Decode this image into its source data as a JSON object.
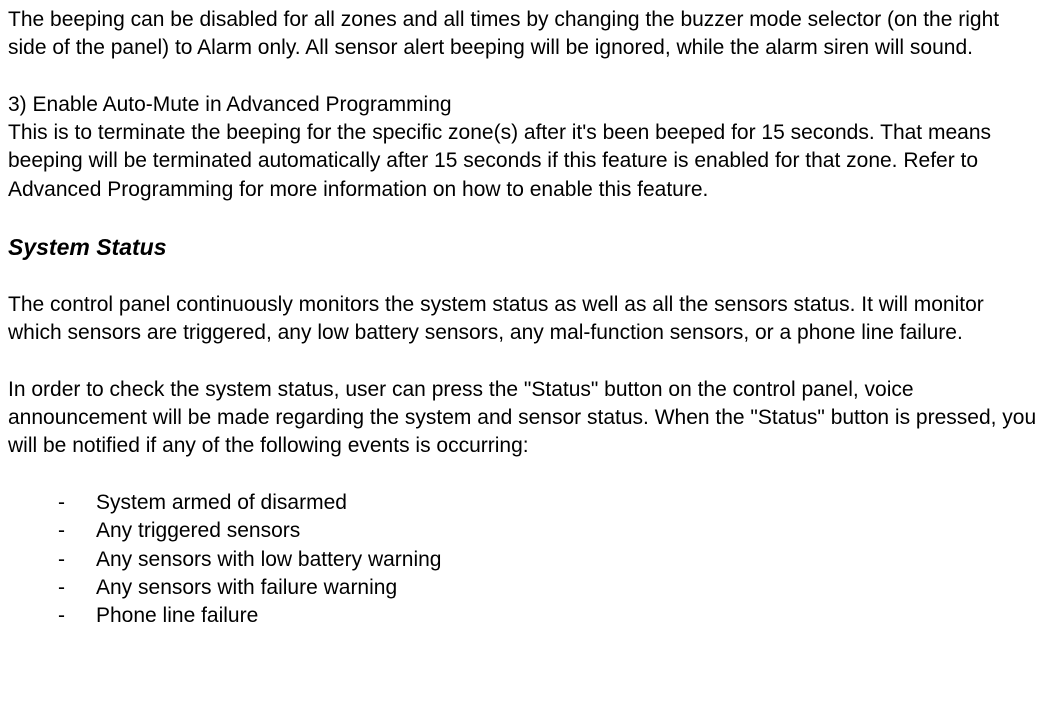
{
  "paragraphs": {
    "p1": "The beeping can be disabled for all zones and all times by changing the buzzer mode selector (on the right side of the panel) to Alarm only.  All sensor alert beeping will be ignored, while the alarm siren will sound.",
    "p2_title": "3)  Enable Auto-Mute in Advanced Programming",
    "p2_body": "This is to terminate the beeping for the specific zone(s) after it's been beeped for 15 seconds.  That means beeping will be terminated automatically after 15 seconds if this feature is enabled for that zone.  Refer to Advanced Programming for more information on how to enable this feature.",
    "heading": "System Status",
    "p3": "The control panel continuously monitors the system status as well as all the sensors status.  It will monitor which sensors are triggered, any low battery sensors, any mal-function sensors, or a phone line failure.",
    "p4": "In order to check the system status, user can press the \"Status\" button on the control panel, voice announcement will be made regarding the system and sensor status.  When the \"Status\" button is pressed, you will be notified if any of the following events is occurring:"
  },
  "list": {
    "items": [
      "System armed of disarmed",
      "Any triggered sensors",
      "Any sensors with low battery warning",
      "Any sensors with failure warning",
      "Phone line failure"
    ]
  }
}
